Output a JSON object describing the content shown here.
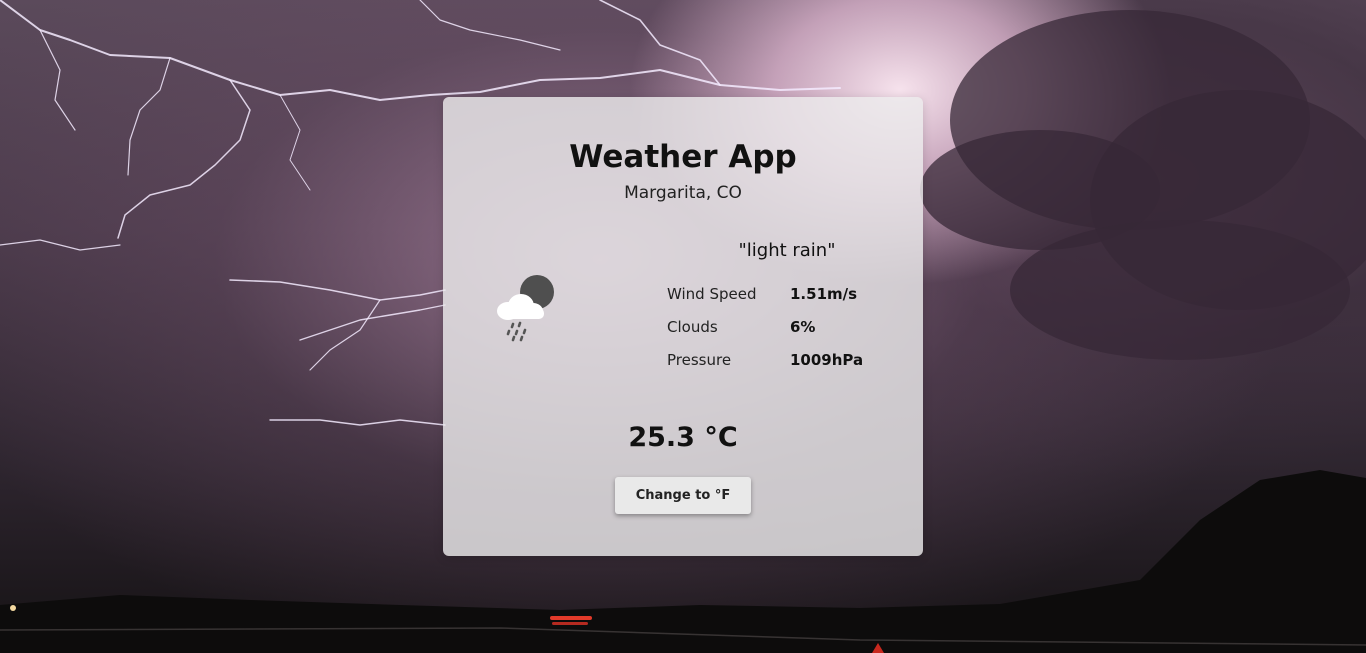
{
  "app": {
    "title": "Weather App",
    "location": "Margarita, CO"
  },
  "weather": {
    "icon": "cloud-rain-moon-icon",
    "description": "\"light rain\"",
    "stats": [
      {
        "label": "Wind Speed",
        "value": "1.51m/s"
      },
      {
        "label": "Clouds",
        "value": "6%"
      },
      {
        "label": "Pressure",
        "value": "1009hPa"
      }
    ],
    "temperature": "25.3 °C"
  },
  "controls": {
    "unit_toggle_label": "Change to °F"
  },
  "background": {
    "scene": "lightning-storm-photo"
  }
}
